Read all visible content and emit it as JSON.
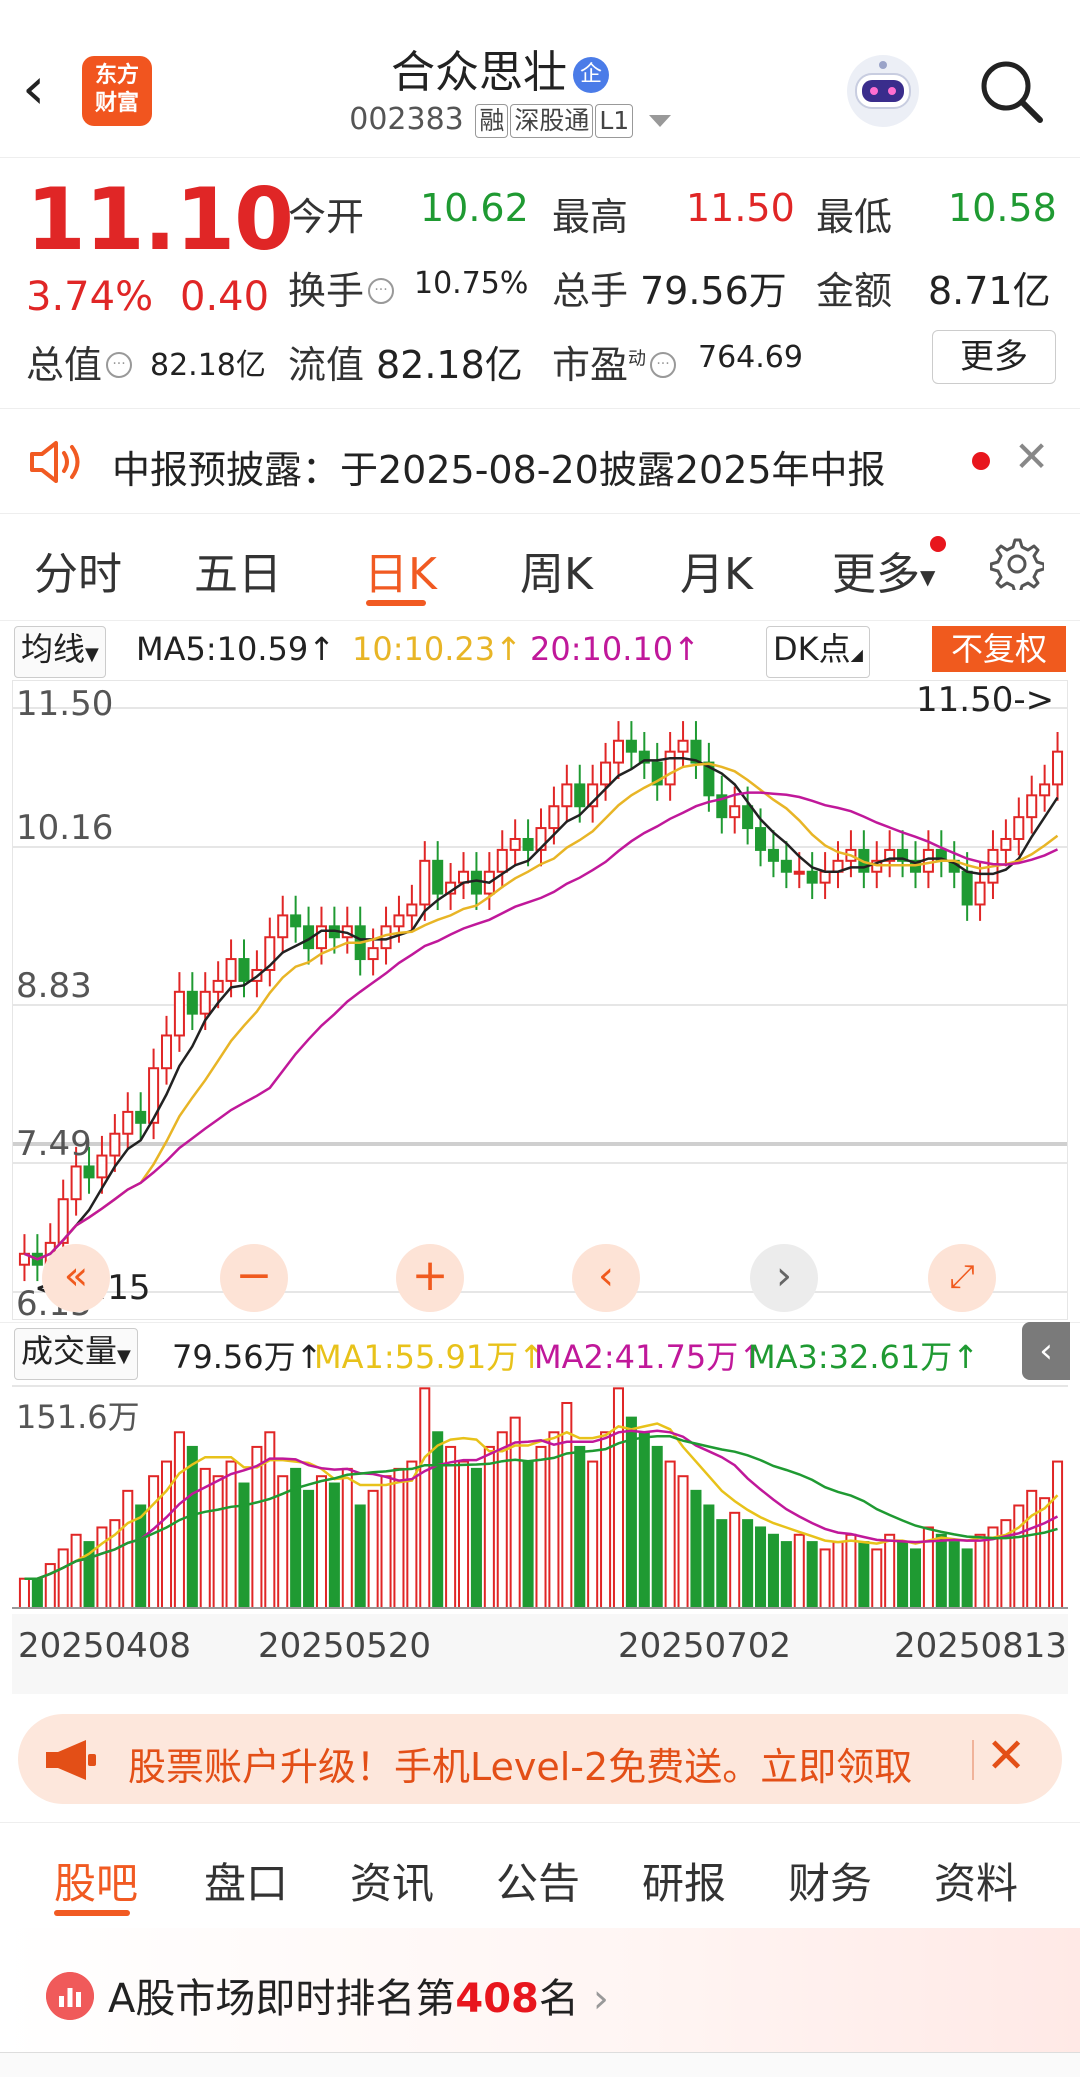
{
  "header": {
    "back_glyph": "‹",
    "logo_text_1": "东方",
    "logo_text_2": "财富",
    "stock_name": "合众思壮",
    "qi_badge": "企",
    "code": "002383",
    "tag_rong": "融",
    "tag_sgt": "深股通",
    "tag_l1": "L1"
  },
  "quote": {
    "price": "11.10",
    "pct": "3.74%",
    "change": "0.40",
    "open_label": "今开",
    "open": "10.62",
    "high_label": "最高",
    "high": "11.50",
    "low_label": "最低",
    "low": "10.58",
    "turnover_label": "换手",
    "turnover": "10.75%",
    "volume_label": "总手",
    "volume": "79.56万",
    "amount_label": "金额",
    "amount": "8.71亿",
    "mktcap_label": "总值",
    "mktcap": "82.18亿",
    "float_label": "流值",
    "float": "82.18亿",
    "pe_label": "市盈",
    "pe_sup": "动",
    "pe": "764.69",
    "more": "更多"
  },
  "notice": {
    "text": "中报预披露：于2025-08-20披露2025年中报",
    "close": "✕"
  },
  "period_tabs": [
    {
      "label": "分时"
    },
    {
      "label": "五日"
    },
    {
      "label": "日K"
    },
    {
      "label": "周K"
    },
    {
      "label": "月K"
    },
    {
      "label": "更多"
    }
  ],
  "ma": {
    "selector": "均线",
    "ma5": "MA5:10.59↑",
    "ma10": "10:10.23↑",
    "ma20": "20:10.10↑",
    "dk": "DK点",
    "fuquan": "不复权",
    "color_ma5": "#222222",
    "color_ma10": "#e8b526",
    "color_ma20": "#c0189a"
  },
  "chart_data": {
    "type": "candlestick",
    "y_ticks": [
      "11.50",
      "10.16",
      "8.83",
      "7.49",
      "6.15"
    ],
    "ylim": [
      6.15,
      11.5
    ],
    "high_annotation": "11.50->",
    "low_annotation": "<-6.15",
    "x_labels": [
      "20250408",
      "20250520",
      "20250702",
      "20250813"
    ],
    "closes": [
      6.5,
      6.4,
      6.6,
      7.0,
      7.3,
      7.2,
      7.4,
      7.6,
      7.8,
      7.7,
      8.2,
      8.5,
      8.9,
      8.7,
      8.9,
      9.0,
      9.2,
      9.0,
      9.1,
      9.4,
      9.6,
      9.5,
      9.3,
      9.5,
      9.4,
      9.5,
      9.2,
      9.3,
      9.5,
      9.6,
      9.7,
      10.1,
      9.8,
      9.9,
      10.0,
      9.8,
      10.0,
      10.2,
      10.3,
      10.2,
      10.4,
      10.6,
      10.8,
      10.6,
      10.8,
      11.0,
      11.2,
      11.1,
      11.0,
      10.8,
      11.1,
      11.2,
      11.0,
      10.7,
      10.5,
      10.6,
      10.4,
      10.2,
      10.1,
      10.0,
      10.0,
      9.9,
      10.0,
      10.1,
      10.2,
      10.0,
      10.1,
      10.2,
      10.1,
      10.0,
      10.2,
      10.1,
      10.0,
      9.7,
      9.9,
      10.2,
      10.3,
      10.5,
      10.7,
      10.8,
      11.1
    ],
    "volume_max_label": "151.6万",
    "volume_values": [
      20,
      20,
      30,
      40,
      50,
      45,
      55,
      60,
      80,
      70,
      90,
      100,
      120,
      110,
      95,
      90,
      100,
      85,
      110,
      120,
      90,
      95,
      80,
      90,
      85,
      95,
      70,
      80,
      90,
      95,
      100,
      150,
      120,
      110,
      100,
      95,
      110,
      120,
      130,
      100,
      110,
      120,
      140,
      110,
      100,
      120,
      150,
      130,
      120,
      110,
      100,
      90,
      80,
      70,
      60,
      65,
      60,
      55,
      50,
      45,
      50,
      45,
      40,
      45,
      50,
      45,
      40,
      50,
      45,
      40,
      55,
      50,
      45,
      40,
      50,
      55,
      60,
      70,
      80,
      75,
      100
    ],
    "volume_ma": {
      "ma1": "MA1:55.91万↑",
      "ma2": "MA2:41.75万↑",
      "ma3": "MA3:32.61万↑"
    },
    "volume_total": "79.56万↑",
    "volume_selector": "成交量"
  },
  "banner": {
    "text": "股票账户升级！手机Level-2免费送。立即领取",
    "close": "✕"
  },
  "bottom_tabs": [
    {
      "label": "股吧"
    },
    {
      "label": "盘口"
    },
    {
      "label": "资讯"
    },
    {
      "label": "公告"
    },
    {
      "label": "研报"
    },
    {
      "label": "财务"
    },
    {
      "label": "资料"
    }
  ],
  "rank": {
    "prefix": "A股市场即时排名第",
    "number": "408",
    "suffix": "名"
  }
}
